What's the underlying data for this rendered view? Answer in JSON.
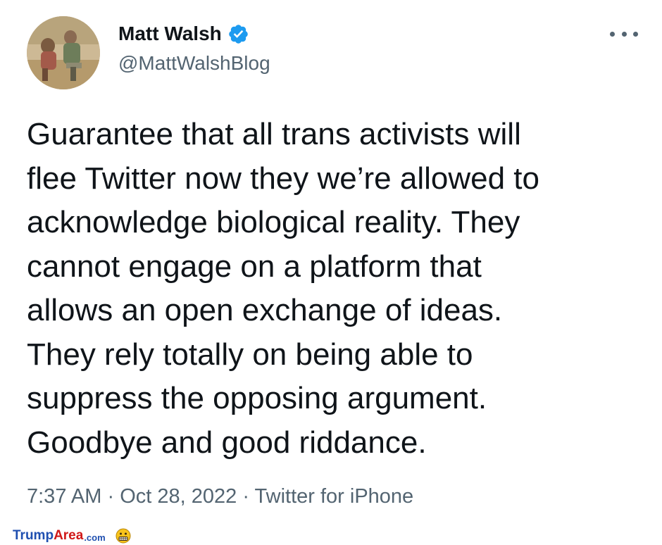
{
  "tweet": {
    "author": {
      "display_name": "Matt Walsh",
      "handle": "@MattWalshBlog",
      "verified": true,
      "avatar_icon": "profile-photo"
    },
    "text_lines": [
      "Guarantee that all trans activists will",
      "flee Twitter now they we’re allowed to",
      "acknowledge biological reality. They",
      "cannot engage on a platform that",
      "allows an open exchange of ideas.",
      "They rely totally on being able to",
      "suppress the opposing argument.",
      "Goodbye and good riddance."
    ],
    "time": "7:37 AM",
    "separator": "·",
    "date": "Oct 28, 2022",
    "source": "Twitter for iPhone",
    "more_icon": "more-options-icon"
  },
  "watermark": {
    "part1": "Trump",
    "part2": "Area",
    "part3": ".com",
    "icon": "grimace-face-icon"
  },
  "colors": {
    "text": "#0f1419",
    "secondary": "#536471",
    "verified": "#1d9bf0",
    "watermark_blue": "#1f4fb0",
    "watermark_red": "#d01818"
  }
}
